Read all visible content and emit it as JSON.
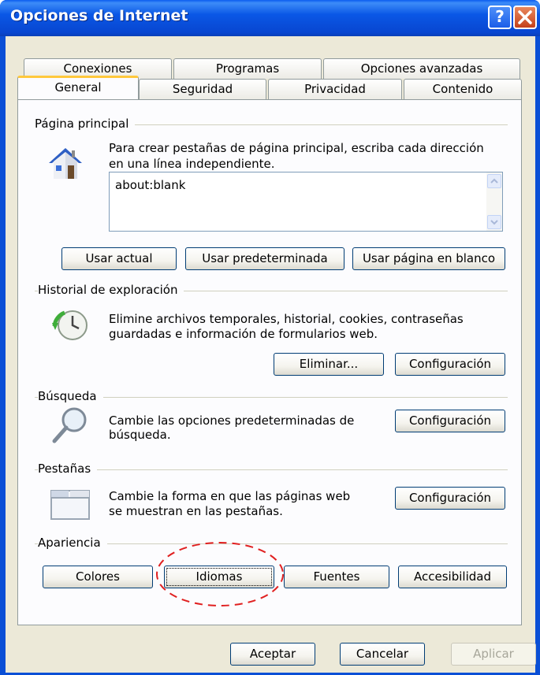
{
  "window": {
    "title": "Opciones de Internet",
    "help_glyph": "?",
    "close_glyph": "✕"
  },
  "tabs_back": [
    "Conexiones",
    "Programas",
    "Opciones avanzadas"
  ],
  "tabs_front": [
    "General",
    "Seguridad",
    "Privacidad",
    "Contenido"
  ],
  "home": {
    "group": "Página principal",
    "description_line1": "Para crear pestañas de página principal, escriba cada dirección",
    "description_line2": "en una línea independiente.",
    "value": "about:blank",
    "buttons": {
      "current": "Usar actual",
      "default": "Usar predeterminada",
      "blank": "Usar página en blanco"
    }
  },
  "history": {
    "group": "Historial de exploración",
    "description_line1": "Elimine archivos temporales, historial, cookies, contraseñas",
    "description_line2": "guardadas e información de formularios web.",
    "buttons": {
      "delete": "Eliminar...",
      "settings": "Configuración"
    }
  },
  "search": {
    "group": "Búsqueda",
    "description_line1": "Cambie las opciones predeterminadas de",
    "description_line2": "búsqueda.",
    "button": "Configuración"
  },
  "tabs_section": {
    "group": "Pestañas",
    "description_line1": "Cambie la forma en que las páginas web",
    "description_line2": "se muestran en las pestañas.",
    "button": "Configuración"
  },
  "appearance": {
    "group": "Apariencia",
    "buttons": {
      "colors": "Colores",
      "languages": "Idiomas",
      "fonts": "Fuentes",
      "accessibility": "Accesibilidad"
    }
  },
  "footer": {
    "ok": "Aceptar",
    "cancel": "Cancelar",
    "apply": "Aplicar"
  },
  "colors": {
    "titlebar": "#0a57e6",
    "dialog": "#ece9d8",
    "highlight_ellipse": "#e02020",
    "tab_accent": "#ffc83c"
  }
}
